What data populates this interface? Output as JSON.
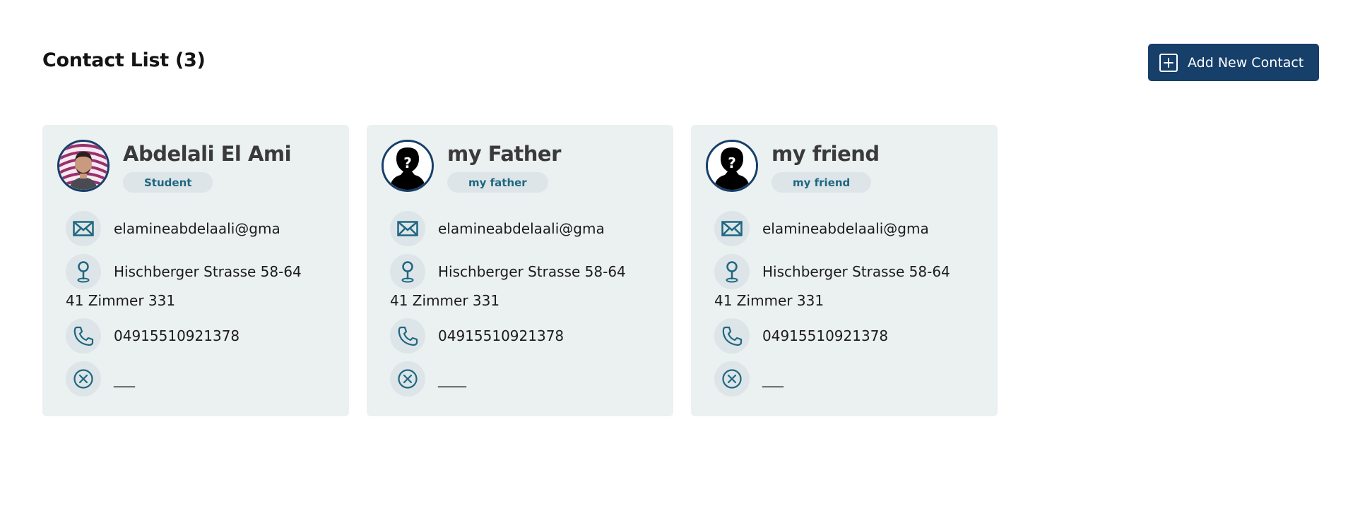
{
  "header": {
    "title": "Contact List (3)",
    "add_button_label": "Add New Contact"
  },
  "contacts": [
    {
      "name": "Abdelali El Ami",
      "tag": "Student",
      "email": "elamineabdelaali@gma",
      "address_line1": "Hischberger Strasse 58-64",
      "address_line2": "41 Zimmer 331",
      "phone": "04915510921378",
      "extra": "___",
      "avatar": "photo"
    },
    {
      "name": "my Father",
      "tag": "my father",
      "email": "elamineabdelaali@gma",
      "address_line1": "Hischberger Strasse 58-64",
      "address_line2": "41 Zimmer 331",
      "phone": "04915510921378",
      "extra": "____",
      "avatar": "unknown-silhouette"
    },
    {
      "name": "my friend",
      "tag": "my friend",
      "email": "elamineabdelaali@gma",
      "address_line1": "Hischberger Strasse 58-64",
      "address_line2": "41 Zimmer 331",
      "phone": "04915510921378",
      "extra": "___",
      "avatar": "unknown-silhouette"
    }
  ],
  "colors": {
    "primary": "#163f6a",
    "card_bg": "#ebf0f1",
    "icon_bg": "#dde5e8",
    "icon_color": "#1f6780"
  },
  "icons": {
    "add": "plus-square-icon",
    "email": "envelope-icon",
    "address": "map-pin-icon",
    "phone": "phone-icon",
    "extra": "close-circle-icon"
  }
}
